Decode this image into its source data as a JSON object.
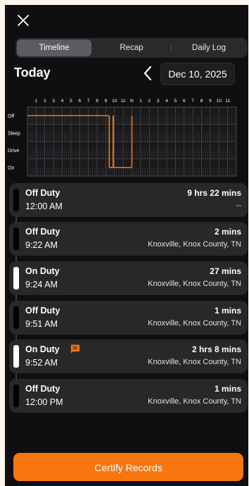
{
  "close_icon": "close-icon",
  "tabs": [
    {
      "label": "Timeline",
      "active": true
    },
    {
      "label": "Recap",
      "active": false
    },
    {
      "label": "Daily Log",
      "active": false
    }
  ],
  "header": {
    "title": "Today",
    "prev_icon": "chevron-left-icon",
    "date": "Dec 10, 2025"
  },
  "graph": {
    "hour_labels": [
      "1",
      "2",
      "3",
      "4",
      "5",
      "6",
      "7",
      "8",
      "9",
      "10",
      "11",
      "N",
      "1",
      "2",
      "3",
      "4",
      "5",
      "6",
      "7",
      "8",
      "9",
      "10",
      "11"
    ],
    "status_rows": [
      "Off",
      "Sleep",
      "Drive",
      "On"
    ],
    "line_color": "#f7760d",
    "segments": [
      {
        "status": "Off",
        "start": "0:00",
        "end": "9:22"
      },
      {
        "status": "Off",
        "start": "9:22",
        "end": "9:24"
      },
      {
        "status": "On",
        "start": "9:24",
        "end": "9:51"
      },
      {
        "status": "Off",
        "start": "9:51",
        "end": "9:52"
      },
      {
        "status": "On",
        "start": "9:52",
        "end": "12:00"
      },
      {
        "status": "Off",
        "start": "12:00",
        "end": "12:01"
      }
    ]
  },
  "entries": [
    {
      "status": "Off Duty",
      "time": "12:00 AM",
      "duration": "9 hrs 22 mins",
      "location": "--",
      "on": false,
      "note": false
    },
    {
      "status": "Off Duty",
      "time": "9:22 AM",
      "duration": "2 mins",
      "location": "Knoxville, Knox County, TN",
      "on": false,
      "note": false
    },
    {
      "status": "On Duty",
      "time": "9:24 AM",
      "duration": "27 mins",
      "location": "Knoxville, Knox County, TN",
      "on": true,
      "note": false
    },
    {
      "status": "Off Duty",
      "time": "9:51 AM",
      "duration": "1 mins",
      "location": "Knoxville, Knox County, TN",
      "on": false,
      "note": false
    },
    {
      "status": "On Duty",
      "time": "9:52 AM",
      "duration": "2 hrs 8 mins",
      "location": "Knoxville, Knox County, TN",
      "on": true,
      "note": true,
      "note_icon": "message-icon"
    },
    {
      "status": "Off Duty",
      "time": "12:00 PM",
      "duration": "1 mins",
      "location": "Knoxville, Knox County, TN",
      "on": false,
      "note": false
    }
  ],
  "certify_label": "Certify Records",
  "accent_color": "#f7760d"
}
